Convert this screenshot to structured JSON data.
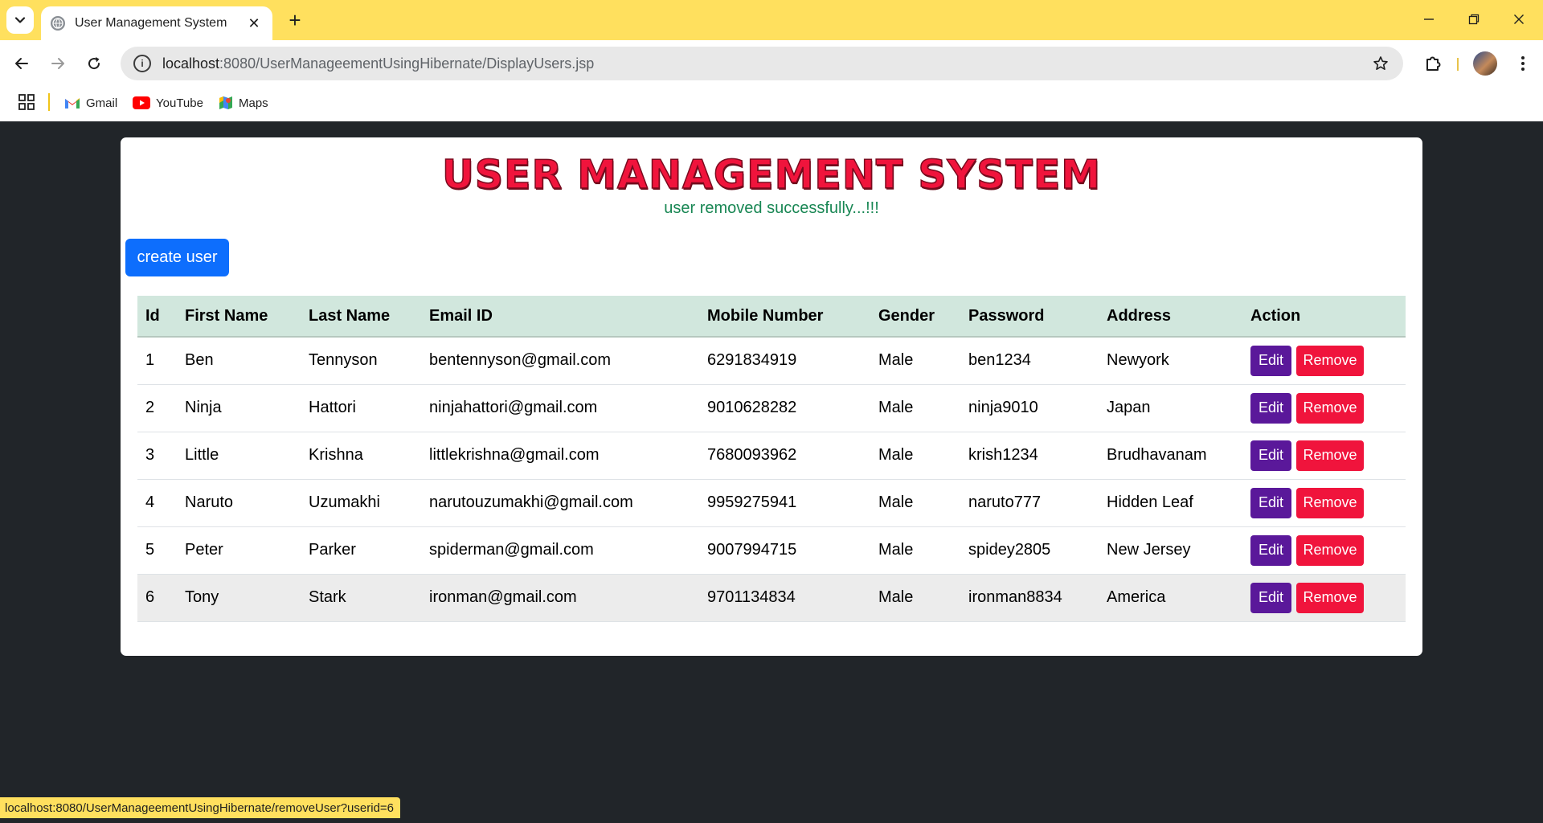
{
  "browser": {
    "tab": {
      "title": "User Management System",
      "close_glyph": "✕"
    },
    "new_tab_glyph": "+",
    "address": {
      "host": "localhost",
      "path": ":8080/UserManageementUsingHibernate/DisplayUsers.jsp"
    },
    "bookmarks": [
      {
        "label": "Gmail",
        "icon": "gmail-icon"
      },
      {
        "label": "YouTube",
        "icon": "youtube-icon"
      },
      {
        "label": "Maps",
        "icon": "maps-icon"
      }
    ],
    "status_url": "localhost:8080/UserManageementUsingHibernate/removeUser?userid=6",
    "accent_color": "#ffe05e"
  },
  "page": {
    "heading": "USER MANAGEMENT SYSTEM",
    "message": "user removed successfully...!!!",
    "create_button": "create user",
    "colors": {
      "heading": "#f0143c",
      "message": "#198754",
      "primary": "#0d6efd",
      "edit": "#5a189a",
      "remove": "#f0143c",
      "header_row": "#d1e7dd"
    }
  },
  "table": {
    "columns": [
      "Id",
      "First Name",
      "Last Name",
      "Email ID",
      "Mobile Number",
      "Gender",
      "Password",
      "Address",
      "Action"
    ],
    "edit_label": "Edit",
    "remove_label": "Remove",
    "rows": [
      {
        "id": "1",
        "first": "Ben",
        "last": "Tennyson",
        "email": "bentennyson@gmail.com",
        "mobile": "6291834919",
        "gender": "Male",
        "password": "ben1234",
        "address": "Newyork"
      },
      {
        "id": "2",
        "first": "Ninja",
        "last": "Hattori",
        "email": "ninjahattori@gmail.com",
        "mobile": "9010628282",
        "gender": "Male",
        "password": "ninja9010",
        "address": "Japan"
      },
      {
        "id": "3",
        "first": "Little",
        "last": "Krishna",
        "email": "littlekrishna@gmail.com",
        "mobile": "7680093962",
        "gender": "Male",
        "password": "krish1234",
        "address": "Brudhavanam"
      },
      {
        "id": "4",
        "first": "Naruto",
        "last": "Uzumakhi",
        "email": "narutouzumakhi@gmail.com",
        "mobile": "9959275941",
        "gender": "Male",
        "password": "naruto777",
        "address": "Hidden Leaf"
      },
      {
        "id": "5",
        "first": "Peter",
        "last": "Parker",
        "email": "spiderman@gmail.com",
        "mobile": "9007994715",
        "gender": "Male",
        "password": "spidey2805",
        "address": "New Jersey"
      },
      {
        "id": "6",
        "first": "Tony",
        "last": "Stark",
        "email": "ironman@gmail.com",
        "mobile": "9701134834",
        "gender": "Male",
        "password": "ironman8834",
        "address": "America",
        "hovered": true
      }
    ]
  }
}
